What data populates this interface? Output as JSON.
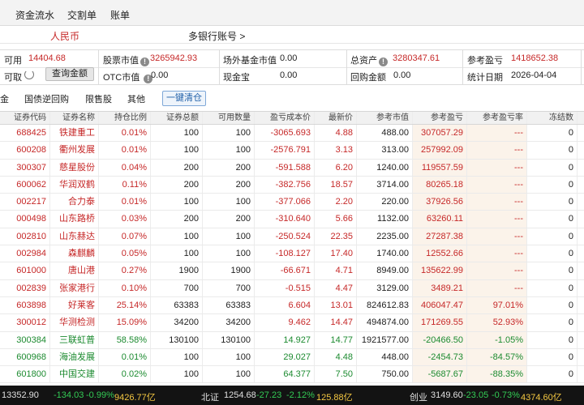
{
  "nav": {
    "items": [
      "资金流水",
      "交割单",
      "账单"
    ]
  },
  "account": {
    "currency": "人民币",
    "multi_bank": "多银行账号 >"
  },
  "summary": {
    "available_label": "可用",
    "available_value": "14404.68",
    "withdrawable_label": "可取",
    "query_button": "查询金额",
    "stock_value_label": "股票市值",
    "stock_value": "3265942.93",
    "otc_label": "OTC市值",
    "otc_value": "0.00",
    "offsite_fund_label": "场外基金市值",
    "offsite_fund_value": "0.00",
    "cash_treasure_label": "现金宝",
    "cash_treasure_value": "0.00",
    "total_assets_label": "总资产",
    "total_assets_value": "3280347.61",
    "repurchase_label": "回购金额",
    "repurchase_value": "0.00",
    "ref_pnl_label": "参考盈亏",
    "ref_pnl_value": "1418652.38",
    "stat_date_label": "统计日期",
    "stat_date_value": "2026-04-04"
  },
  "tabs": {
    "items": [
      "金",
      "国债逆回购",
      "限售股",
      "其他"
    ],
    "clear_button": "一键清仓"
  },
  "table": {
    "headers": [
      "证券代码",
      "证券名称",
      "持仓比例",
      "证券总额",
      "可用数量",
      "盈亏成本价",
      "最新价",
      "参考市值",
      "参考盈亏",
      "参考盈亏率",
      "冻结数"
    ],
    "rows": [
      [
        "688425",
        "铁建重工",
        "0.01%",
        "100",
        "100",
        "-3065.693",
        "4.88",
        "488.00",
        "307057.29",
        "---",
        "0"
      ],
      [
        "600208",
        "衢州发展",
        "0.01%",
        "100",
        "100",
        "-2576.791",
        "3.13",
        "313.00",
        "257992.09",
        "---",
        "0"
      ],
      [
        "300307",
        "慈星股份",
        "0.04%",
        "200",
        "200",
        "-591.588",
        "6.20",
        "1240.00",
        "119557.59",
        "---",
        "0"
      ],
      [
        "600062",
        "华润双鹤",
        "0.11%",
        "200",
        "200",
        "-382.756",
        "18.57",
        "3714.00",
        "80265.18",
        "---",
        "0"
      ],
      [
        "002217",
        "合力泰",
        "0.01%",
        "100",
        "100",
        "-377.066",
        "2.20",
        "220.00",
        "37926.56",
        "---",
        "0"
      ],
      [
        "000498",
        "山东路桥",
        "0.03%",
        "200",
        "200",
        "-310.640",
        "5.66",
        "1132.00",
        "63260.11",
        "---",
        "0"
      ],
      [
        "002810",
        "山东赫达",
        "0.07%",
        "100",
        "100",
        "-250.524",
        "22.35",
        "2235.00",
        "27287.38",
        "---",
        "0"
      ],
      [
        "002984",
        "森麒麟",
        "0.05%",
        "100",
        "100",
        "-108.127",
        "17.40",
        "1740.00",
        "12552.66",
        "---",
        "0"
      ],
      [
        "601000",
        "唐山港",
        "0.27%",
        "1900",
        "1900",
        "-66.671",
        "4.71",
        "8949.00",
        "135622.99",
        "---",
        "0"
      ],
      [
        "002839",
        "张家港行",
        "0.10%",
        "700",
        "700",
        "-0.515",
        "4.47",
        "3129.00",
        "3489.21",
        "---",
        "0"
      ],
      [
        "603898",
        "好莱客",
        "25.14%",
        "63383",
        "63383",
        "6.604",
        "13.01",
        "824612.83",
        "406047.47",
        "97.01%",
        "0"
      ],
      [
        "300012",
        "华测检测",
        "15.09%",
        "34200",
        "34200",
        "9.462",
        "14.47",
        "494874.00",
        "171269.55",
        "52.93%",
        "0"
      ],
      [
        "300384",
        "三联虹普",
        "58.58%",
        "130100",
        "130100",
        "14.927",
        "14.77",
        "1921577.00",
        "-20466.50",
        "-1.05%",
        "0"
      ],
      [
        "600968",
        "海油发展",
        "0.01%",
        "100",
        "100",
        "29.027",
        "4.48",
        "448.00",
        "-2454.73",
        "-84.57%",
        "0"
      ],
      [
        "601800",
        "中国交建",
        "0.02%",
        "100",
        "100",
        "64.377",
        "7.50",
        "750.00",
        "-5687.67",
        "-88.35%",
        "0"
      ]
    ]
  },
  "ticker": {
    "s1": "13352.90",
    "s1_chg": "-134.03",
    "s1_pct": "-0.99%",
    "s1_vol": "9426.77亿",
    "north_label": "北证",
    "north_val": "1254.68",
    "north_chg": "-27.23",
    "north_pct": "-2.12%",
    "north_vol": "125.88亿",
    "gem_label": "创业",
    "gem_val": "3149.60",
    "gem_chg": "-23.05",
    "gem_pct": "-0.73%",
    "gem_vol": "4374.60亿"
  },
  "colors": {
    "red": "#c62828",
    "green": "#1b8a2f",
    "highlight": "#fbf3ea"
  }
}
